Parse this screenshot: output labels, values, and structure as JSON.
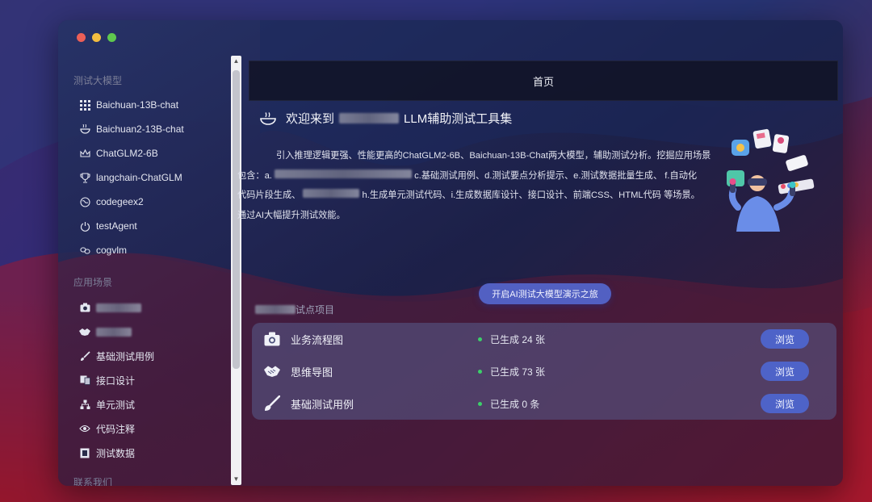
{
  "sidebar": {
    "section1_title": "测试大模型",
    "models": [
      {
        "label": "Baichuan-13B-chat",
        "icon": "grid-icon"
      },
      {
        "label": "Baichuan2-13B-chat",
        "icon": "bowl-icon"
      },
      {
        "label": "ChatGLM2-6B",
        "icon": "crown-icon"
      },
      {
        "label": "langchain-ChatGLM",
        "icon": "trophy-icon"
      },
      {
        "label": "codegeex2",
        "icon": "globe-icon"
      },
      {
        "label": "testAgent",
        "icon": "power-icon"
      },
      {
        "label": "cogvlm",
        "icon": "link-icon"
      }
    ],
    "section2_title": "应用场景",
    "scenes": [
      {
        "label": "",
        "icon": "camera-icon"
      },
      {
        "label": "",
        "icon": "handshake-icon"
      },
      {
        "label": "基础测试用例",
        "icon": "brush-icon"
      },
      {
        "label": "接口设计",
        "icon": "cards-icon"
      },
      {
        "label": "单元测试",
        "icon": "sitemap-icon"
      },
      {
        "label": "代码注释",
        "icon": "eye-icon"
      },
      {
        "label": "测试数据",
        "icon": "film-icon"
      }
    ],
    "section3_title": "联系我们"
  },
  "header": {
    "title": "首页"
  },
  "welcome": {
    "prefix": "欢迎来到",
    "suffix": "LLM辅助测试工具集"
  },
  "intro": {
    "line1": "引入推理逻辑更强、性能更高的ChatGLM2-6B、Baichuan-13B-Chat两大模型，辅助测试分析。挖掘应用场景",
    "line2_a": "包含：a.",
    "line2_b": "c.基础测试用例、d.测试要点分析提示、e.测试数据批量生成、 f.自动化",
    "line3_a": "代码片段生成、",
    "line3_b": "h.生成单元测试代码、i.生成数据库设计、接口设计、前端CSS、HTML代码 等场景。",
    "line4": "通过AI大幅提升测试效能。"
  },
  "cta": {
    "label": "开启AI测试大模型演示之旅"
  },
  "projects": {
    "title_suffix": "试点项目",
    "browse_label": "浏览",
    "items": [
      {
        "name": "业务流程图",
        "status": "已生成 24 张",
        "icon": "camera-icon"
      },
      {
        "name": "思维导图",
        "status": "已生成 73 张",
        "icon": "handshake-icon"
      },
      {
        "name": "基础测试用例",
        "status": "已生成 0 条",
        "icon": "brush-icon"
      }
    ]
  },
  "colors": {
    "accent": "#5260c2",
    "status_dot": "#3ccf6a"
  }
}
